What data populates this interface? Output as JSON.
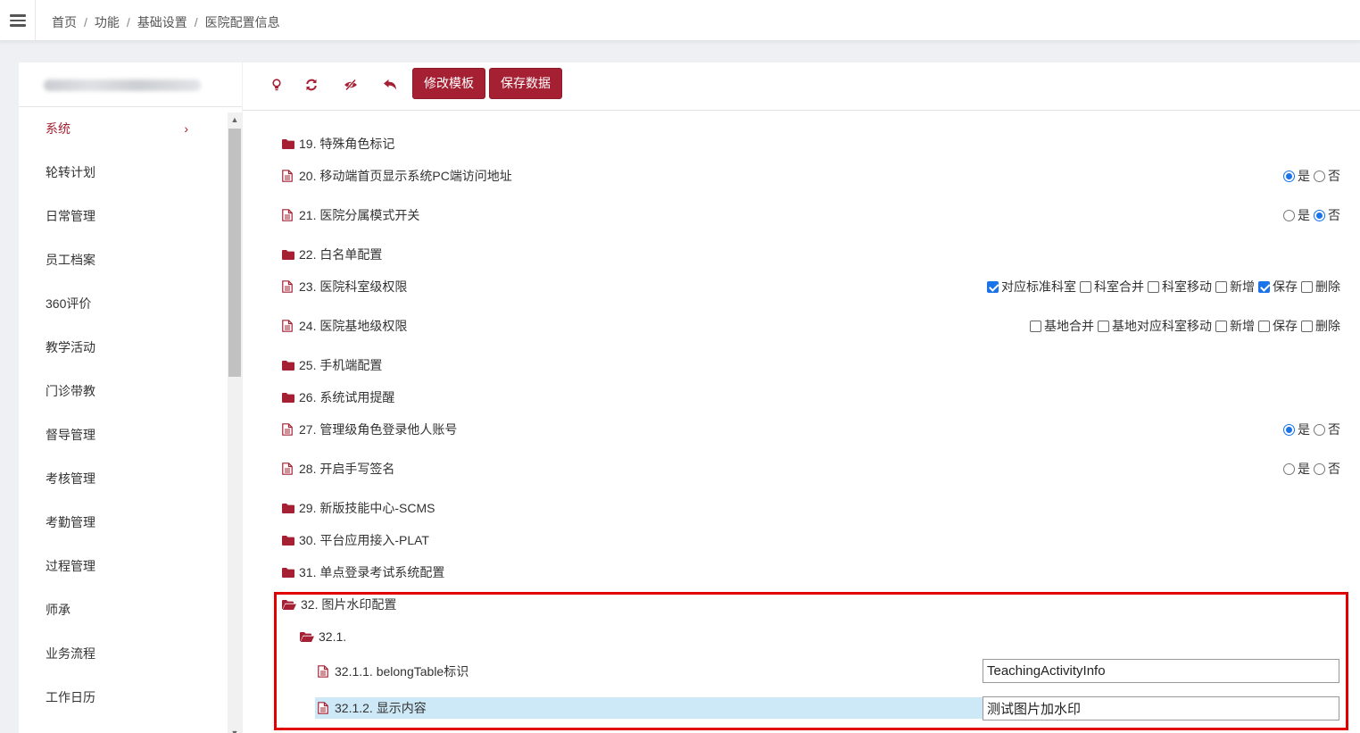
{
  "breadcrumb": [
    "首页",
    "功能",
    "基础设置",
    "医院配置信息"
  ],
  "sidebar": {
    "items": [
      {
        "label": "系统",
        "active": true
      },
      {
        "label": "轮转计划"
      },
      {
        "label": "日常管理"
      },
      {
        "label": "员工档案"
      },
      {
        "label": "360评价"
      },
      {
        "label": "教学活动"
      },
      {
        "label": "门诊带教"
      },
      {
        "label": "督导管理"
      },
      {
        "label": "考核管理"
      },
      {
        "label": "考勤管理"
      },
      {
        "label": "过程管理"
      },
      {
        "label": "师承"
      },
      {
        "label": "业务流程"
      },
      {
        "label": "工作日历"
      }
    ]
  },
  "toolbar": {
    "icons": [
      "lightbulb-icon",
      "refresh-icon",
      "eye-slash-icon",
      "undo-icon"
    ],
    "modify_template": "修改模板",
    "save_data": "保存数据"
  },
  "options": {
    "yes": "是",
    "no": "否"
  },
  "config": {
    "item19": "19. 特殊角色标记",
    "item20": "20. 移动端首页显示系统PC端访问地址",
    "item21": "21. 医院分属模式开关",
    "item22": "22. 白名单配置",
    "item23": "23. 医院科室级权限",
    "item23_opts": [
      {
        "label": "对应标准科室",
        "checked": true
      },
      {
        "label": "科室合并",
        "checked": false
      },
      {
        "label": "科室移动",
        "checked": false
      },
      {
        "label": "新增",
        "checked": false
      },
      {
        "label": "保存",
        "checked": true
      },
      {
        "label": "删除",
        "checked": false
      }
    ],
    "item24": "24. 医院基地级权限",
    "item24_opts": [
      {
        "label": "基地合并",
        "checked": false
      },
      {
        "label": "基地对应科室移动",
        "checked": false
      },
      {
        "label": "新增",
        "checked": false
      },
      {
        "label": "保存",
        "checked": false
      },
      {
        "label": "删除",
        "checked": false
      }
    ],
    "item25": "25. 手机端配置",
    "item26": "26. 系统试用提醒",
    "item27": "27. 管理级角色登录他人账号",
    "item28": "28. 开启手写签名",
    "item29": "29. 新版技能中心-SCMS",
    "item30": "30. 平台应用接入-PLAT",
    "item31": "31. 单点登录考试系统配置",
    "item32": "32. 图片水印配置",
    "item32_1": "32.1.",
    "item32_1_1": "32.1.1. belongTable标识",
    "item32_1_1_value": "TeachingActivityInfo",
    "item32_1_2": "32.1.2. 显示内容",
    "item32_1_2_value": "测试图片加水印"
  },
  "colors": {
    "brand": "#a52033",
    "accent": "#1a73e8",
    "highlight": "#e00000",
    "selection": "#cde8f6"
  }
}
